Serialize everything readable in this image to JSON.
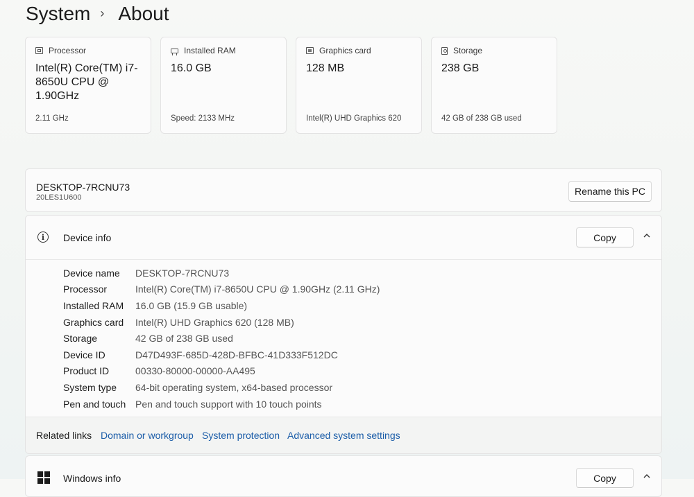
{
  "breadcrumb": {
    "parent": "System",
    "current": "About"
  },
  "spec_cards": [
    {
      "icon": "processor-icon",
      "label": "Processor",
      "value": "Intel(R) Core(TM) i7-8650U CPU @ 1.90GHz",
      "sub": "2.11 GHz"
    },
    {
      "icon": "ram-icon",
      "label": "Installed RAM",
      "value": "16.0 GB",
      "sub": "Speed: 2133 MHz"
    },
    {
      "icon": "graphics-card-icon",
      "label": "Graphics card",
      "value": "128 MB",
      "sub": "Intel(R) UHD Graphics 620"
    },
    {
      "icon": "storage-icon",
      "label": "Storage",
      "value": "238 GB",
      "sub": "42 GB of 238 GB used"
    }
  ],
  "pc": {
    "name": "DESKTOP-7RCNU73",
    "model": "20LES1U600",
    "rename_label": "Rename this PC"
  },
  "device_info": {
    "title": "Device info",
    "copy_label": "Copy",
    "rows": [
      {
        "label": "Device name",
        "value": "DESKTOP-7RCNU73"
      },
      {
        "label": "Processor",
        "value": "Intel(R) Core(TM) i7-8650U CPU @ 1.90GHz (2.11 GHz)"
      },
      {
        "label": "Installed RAM",
        "value": "16.0 GB (15.9 GB usable)"
      },
      {
        "label": "Graphics card",
        "value": "Intel(R) UHD Graphics 620 (128 MB)"
      },
      {
        "label": "Storage",
        "value": "42 GB of 238 GB used"
      },
      {
        "label": "Device ID",
        "value": "D47D493F-685D-428D-BFBC-41D333F512DC"
      },
      {
        "label": "Product ID",
        "value": "00330-80000-00000-AA495"
      },
      {
        "label": "System type",
        "value": "64-bit operating system, x64-based processor"
      },
      {
        "label": "Pen and touch",
        "value": "Pen and touch support with 10 touch points"
      }
    ]
  },
  "related_links": {
    "label": "Related links",
    "links": [
      "Domain or workgroup",
      "System protection",
      "Advanced system settings"
    ]
  },
  "windows_info": {
    "title": "Windows info",
    "copy_label": "Copy"
  },
  "colors": {
    "link": "#1a5ca8",
    "card_bg": "#fbfbfb",
    "border": "#e3e3e3"
  }
}
